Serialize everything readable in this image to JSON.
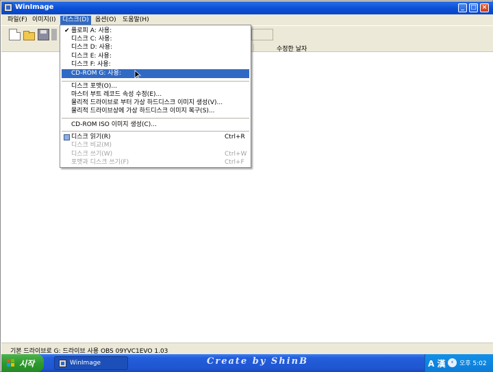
{
  "window": {
    "title": "WinImage"
  },
  "menubar": {
    "items": [
      "파일(F)",
      "이미지(I)",
      "디스크(D)",
      "옵션(O)",
      "도움말(H)"
    ]
  },
  "list": {
    "columns": [
      "수정한 날자"
    ]
  },
  "disk_menu": {
    "drives": [
      "플로피 A: 사용:",
      "디스크 C: 사용:",
      "디스크 D: 사용:",
      "디스크 E: 사용:",
      "디스크 F: 사용:",
      "CD-ROM G: 사용:"
    ],
    "group2": [
      "디스크 포맷(O)...",
      "마스터 부트 레코드 속성 수정(E)...",
      "물리적 드라이브로 부터 가상 하드디스크 이미지 생성(V)...",
      "물리적 드라이브상에 가상 하드디스크 이미지 복구(S)..."
    ],
    "group3": [
      "CD-ROM ISO 이미지 생성(C)..."
    ],
    "group4": [
      {
        "label": "디스크 읽기(R)",
        "shortcut": "Ctrl+R"
      },
      {
        "label": "디스크 비교(M)",
        "shortcut": ""
      },
      {
        "label": "디스크 쓰기(W)",
        "shortcut": "Ctrl+W"
      },
      {
        "label": "포맷과 디스크 쓰기(F)",
        "shortcut": "Ctrl+F"
      }
    ]
  },
  "statusbar": {
    "text": "기본 드라이브로 G: 드라이브 사용 OBS 09YVC1EVO 1.03"
  },
  "taskbar": {
    "start_label": "시작",
    "task_label": "WinImage",
    "watermark": "Create by ShinB",
    "ime": "A 漢",
    "clock": "오후 5:02"
  }
}
